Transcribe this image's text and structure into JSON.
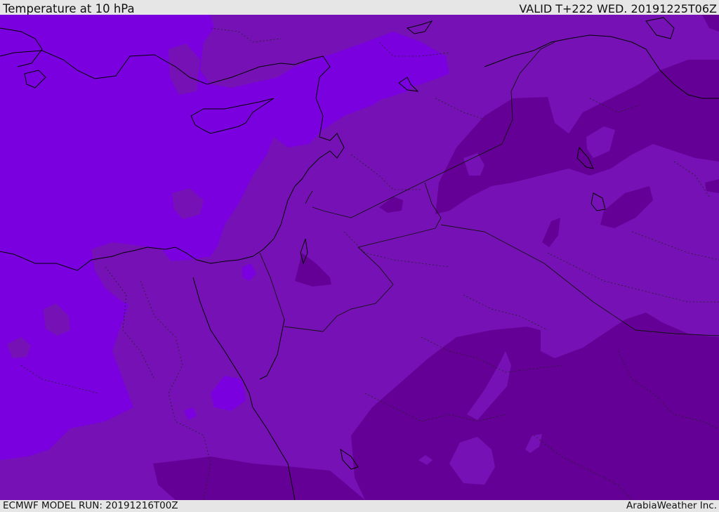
{
  "header": {
    "title": "Temperature at 10 hPa",
    "valid_time": "VALID T+222 WED. 20191225T06Z"
  },
  "footer": {
    "model_run": "ECMWF MODEL RUN: 20191216T00Z",
    "credit": "ArabiaWeather Inc."
  },
  "map": {
    "colors": {
      "band_light": "#7b00e0",
      "band_mid": "#7612b5",
      "band_dark": "#650096",
      "coastline": "#000000",
      "borders": "#222222"
    }
  }
}
